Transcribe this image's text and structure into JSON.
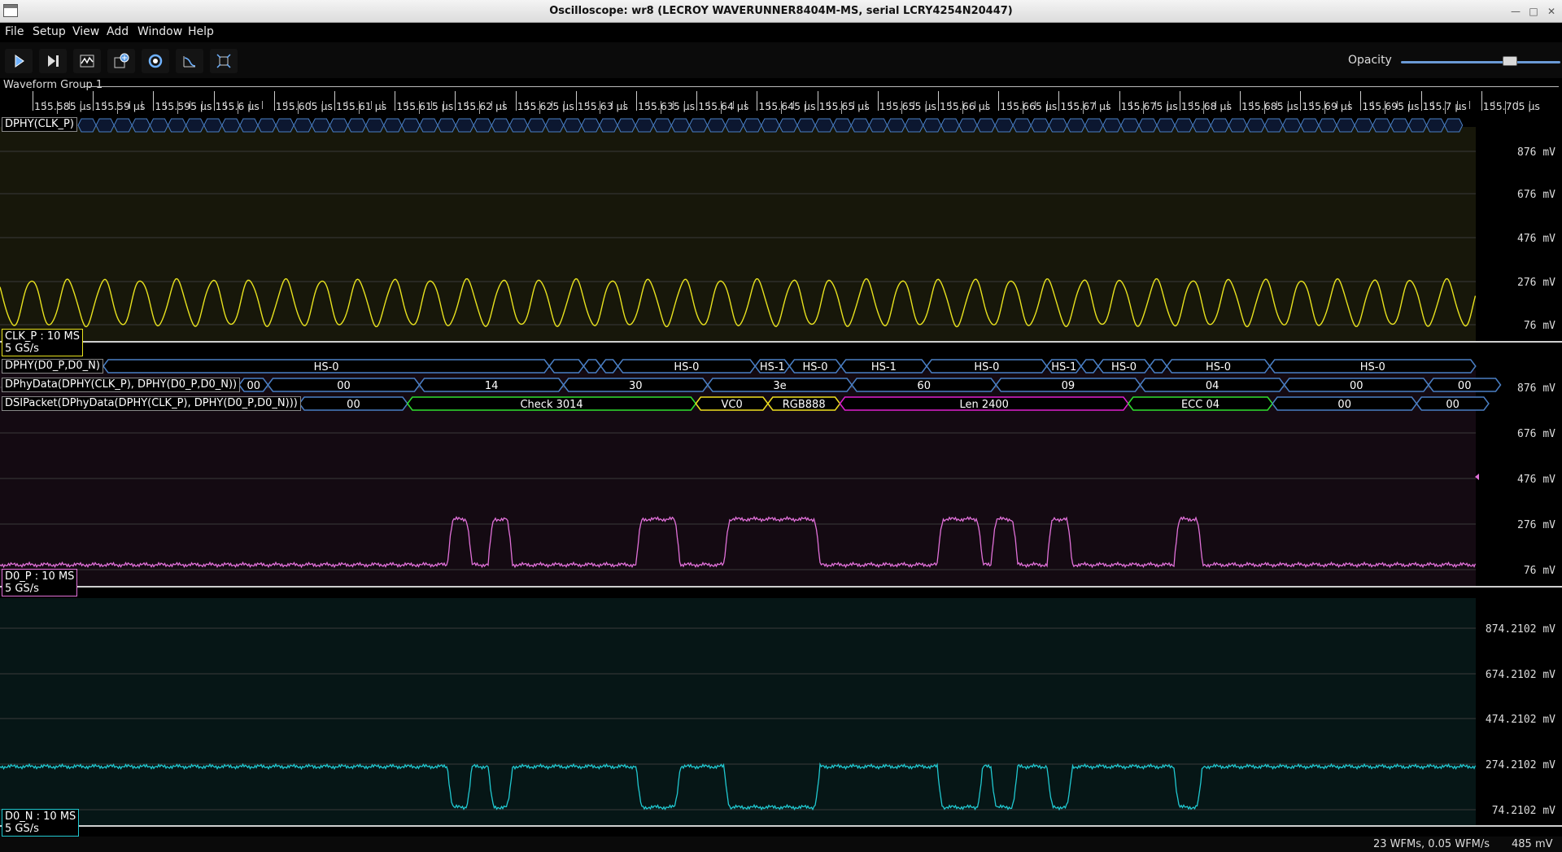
{
  "window": {
    "title": "Oscilloscope: wr8 (LECROY WAVERUNNER8404M-MS, serial LCRY4254N20447)"
  },
  "menu": [
    {
      "label": "File"
    },
    {
      "label": "Setup"
    },
    {
      "label": "View"
    },
    {
      "label": "Add"
    },
    {
      "label": "Window"
    },
    {
      "label": "Help"
    }
  ],
  "toolbar": {
    "buttons": [
      {
        "name": "start-trigger-button",
        "icon": "play-icon"
      },
      {
        "name": "single-trigger-button",
        "icon": "step-forward-icon"
      },
      {
        "name": "history-button",
        "icon": "waveform-icon"
      },
      {
        "name": "add-trace-button",
        "icon": "add-trace-icon"
      },
      {
        "name": "refresh-button",
        "icon": "refresh-icon"
      },
      {
        "name": "measure-button",
        "icon": "measure-icon"
      },
      {
        "name": "fit-button",
        "icon": "fit-icon"
      }
    ],
    "opacity_label": "Opacity",
    "opacity_value": 0.6
  },
  "group": {
    "label": "Waveform Group 1"
  },
  "timeline": {
    "ticks": [
      "155.585 µs",
      "155.59 µs",
      "155.595 µs",
      "155.6 µs",
      "155.605 µs",
      "155.61 µs",
      "155.615 µs",
      "155.62 µs",
      "155.625 µs",
      "155.63 µs",
      "155.635 µs",
      "155.64 µs",
      "155.645 µs",
      "155.65 µs",
      "155.655 µs",
      "155.66 µs",
      "155.665 µs",
      "155.67 µs",
      "155.675 µs",
      "155.68 µs",
      "155.685 µs",
      "155.69 µs",
      "155.695 µs",
      "155.7 µs",
      "155.705 µs"
    ]
  },
  "clk_decode": {
    "label": "DPHY(CLK_P)"
  },
  "clk_panel": {
    "color": "#e8e21e",
    "yticks": [
      "876 mV",
      "676 mV",
      "476 mV",
      "276 mV",
      "76 mV"
    ],
    "channel_name": "CLK_P : 10 MS",
    "sample_rate": "5 GS/s"
  },
  "d0_decodes": [
    {
      "label": "DPHY(D0_P,D0_N)",
      "segments": [
        {
          "text": "HS-0",
          "x0": 0,
          "x1": 13
        },
        {
          "text": "",
          "x0": 13,
          "x1": 14
        },
        {
          "text": "",
          "x0": 14,
          "x1": 14.5
        },
        {
          "text": "",
          "x0": 14.5,
          "x1": 15
        },
        {
          "text": "HS-0",
          "x0": 15,
          "x1": 19
        },
        {
          "text": "HS-1",
          "x0": 19,
          "x1": 20
        },
        {
          "text": "HS-0",
          "x0": 20,
          "x1": 21.5
        },
        {
          "text": "HS-1",
          "x0": 21.5,
          "x1": 24
        },
        {
          "text": "HS-0",
          "x0": 24,
          "x1": 27.5
        },
        {
          "text": "HS-1",
          "x0": 27.5,
          "x1": 28.5
        },
        {
          "text": "",
          "x0": 28.5,
          "x1": 29
        },
        {
          "text": "HS-0",
          "x0": 29,
          "x1": 30.5
        },
        {
          "text": "",
          "x0": 30.5,
          "x1": 31
        },
        {
          "text": "HS-0",
          "x0": 31,
          "x1": 34
        },
        {
          "text": "HS-0",
          "x0": 34,
          "x1": 40
        }
      ]
    },
    {
      "label": "DPhyData(DPHY(CLK_P), DPHY(D0_P,D0_N))",
      "segments": [
        {
          "text": "00",
          "x0": 0,
          "x1": 0.8
        },
        {
          "text": "00",
          "x0": 0.8,
          "x1": 5
        },
        {
          "text": "14",
          "x0": 5,
          "x1": 9
        },
        {
          "text": "30",
          "x0": 9,
          "x1": 13
        },
        {
          "text": "3e",
          "x0": 13,
          "x1": 17
        },
        {
          "text": "60",
          "x0": 17,
          "x1": 21
        },
        {
          "text": "09",
          "x0": 21,
          "x1": 25
        },
        {
          "text": "04",
          "x0": 25,
          "x1": 29
        },
        {
          "text": "00",
          "x0": 29,
          "x1": 33
        },
        {
          "text": "00",
          "x0": 33,
          "x1": 35
        }
      ]
    },
    {
      "label": "DSIPacket(DPhyData(DPHY(CLK_P), DPHY(D0_P,D0_N)))",
      "segments": [
        {
          "text": "00",
          "x0": 0,
          "x1": 3,
          "color": "#4a7fc4"
        },
        {
          "text": "Check 3014",
          "x0": 3,
          "x1": 11,
          "color": "#2fe02f"
        },
        {
          "text": "VC0",
          "x0": 11,
          "x1": 13,
          "color": "#f0e020"
        },
        {
          "text": "RGB888",
          "x0": 13,
          "x1": 15,
          "color": "#f0e020"
        },
        {
          "text": "Len 2400",
          "x0": 15,
          "x1": 23,
          "color": "#e020d0"
        },
        {
          "text": "ECC 04",
          "x0": 23,
          "x1": 27,
          "color": "#2fe02f"
        },
        {
          "text": "00",
          "x0": 27,
          "x1": 31,
          "color": "#4a7fc4"
        },
        {
          "text": "00",
          "x0": 31,
          "x1": 33,
          "color": "#4a7fc4"
        }
      ]
    }
  ],
  "d0p_panel": {
    "color": "#e070d8",
    "yticks": [
      "876 mV",
      "676 mV",
      "476 mV",
      "276 mV",
      "76 mV"
    ],
    "channel_name": "D0_P : 10 MS",
    "sample_rate": "5 GS/s"
  },
  "d0n_panel": {
    "color": "#20c8d0",
    "yticks": [
      "874.2102 mV",
      "674.2102 mV",
      "474.2102 mV",
      "274.2102 mV",
      "74.2102 mV"
    ],
    "channel_name": "D0_N : 10 MS",
    "sample_rate": "5 GS/s"
  },
  "status": {
    "rate": "23 WFMs, 0.05 WFM/s",
    "voltage": "485 mV"
  }
}
